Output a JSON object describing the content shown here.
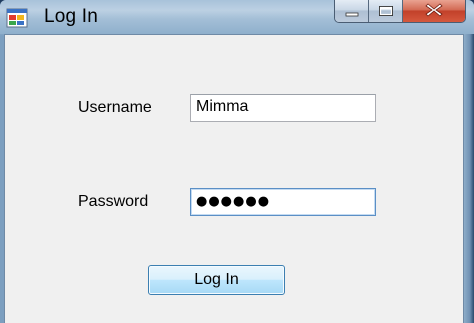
{
  "window": {
    "title": "Log In",
    "app_icon": "windows-form-icon"
  },
  "caption_buttons": {
    "minimize_icon": "minimize-icon",
    "maximize_icon": "maximize-icon",
    "close_icon": "close-icon"
  },
  "form": {
    "username_label": "Username",
    "username_value": "Mimma",
    "password_label": "Password",
    "password_masked": "●●●●●●",
    "login_button_label": "Log In"
  },
  "colors": {
    "close_button": "#c2412a",
    "button_accent": "#3c7fb1",
    "client_background": "#f0f0f0"
  }
}
